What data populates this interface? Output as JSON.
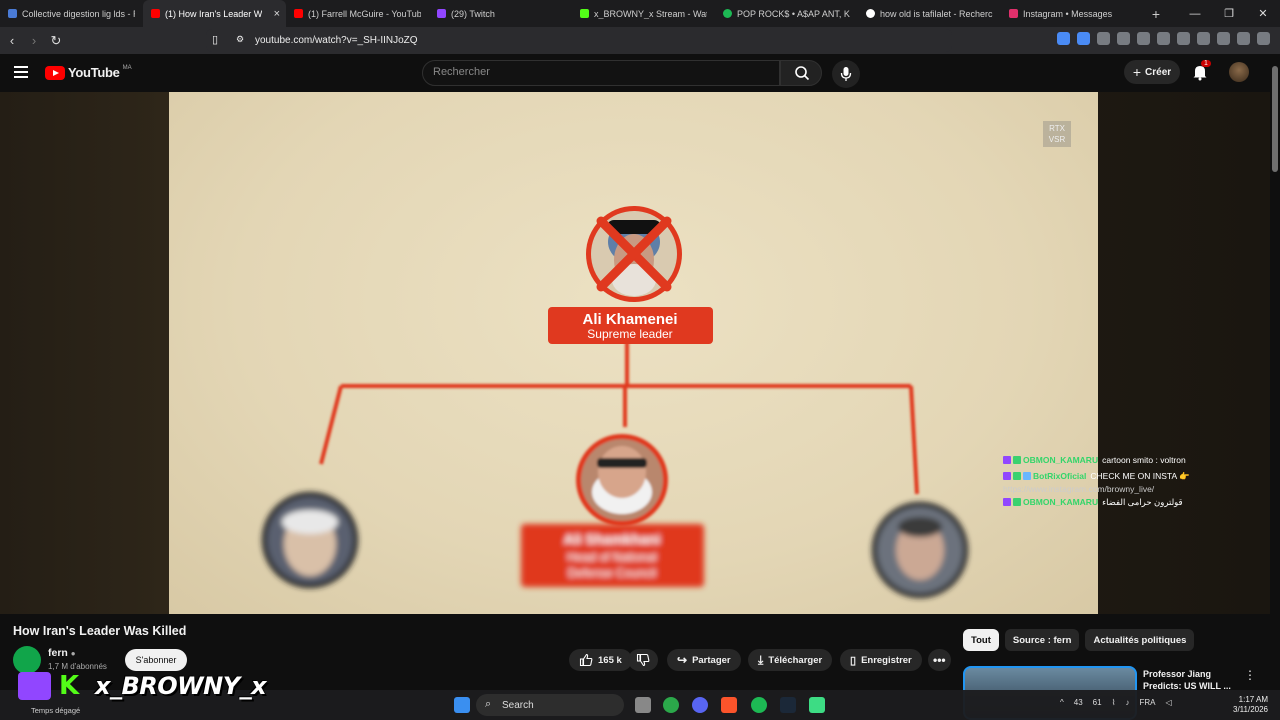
{
  "browser": {
    "tabs": [
      {
        "label": "Collective digestion lig lds - Re",
        "color": "#4a7bd6"
      },
      {
        "label": "(1) How Iran's Leader W",
        "color": "#ff0000",
        "active": true
      },
      {
        "label": "(1) Farrell McGuire - YouTube",
        "color": "#ff0000"
      },
      {
        "label": "(29) Twitch",
        "color": "#9146ff"
      },
      {
        "label": "x_BROWNY_x Stream - Watch",
        "color": "#53fc18"
      },
      {
        "label": "POP ROCK$ • A$AP ANT, K",
        "color": "#1db954"
      },
      {
        "label": "how old is tafilalet - Recherche",
        "color": "#ffffff"
      },
      {
        "label": "Instagram • Messages",
        "color": "#e1306c"
      }
    ],
    "url": "youtube.com/watch?v=_SH-IINJoZQ"
  },
  "youtube": {
    "logo_text": "YouTube",
    "country_code": "MA",
    "search_placeholder": "Rechercher",
    "create_label": "Créer",
    "notif_count": "1"
  },
  "video": {
    "overlay_badge_line1": "RTX",
    "overlay_badge_line2": "VSR",
    "diagram": {
      "top_name": "Ali Khamenei",
      "top_role": "Supreme leader",
      "mid_name": "Ali Shamkhani",
      "mid_role_line1": "Head of National",
      "mid_role_line2": "Defense Council"
    }
  },
  "chat": [
    {
      "user": "OBMON_KAMARU",
      "message": "cartoon smito : voltron"
    },
    {
      "user": "BotRixOficial",
      "message": "CHECK ME ON INSTA 👉",
      "link": "https://www.instagram.com/browny_live/"
    },
    {
      "user": "OBMON_KAMARU",
      "message": "قولترون حرامى الفضاء"
    }
  ],
  "info": {
    "title": "How Iran's Leader Was Killed",
    "channel": "fern",
    "subscribers": "1,7 M d'abonnés",
    "subscribe_label": "S'abonner",
    "likes": "165 k",
    "share": "Partager",
    "download": "Télécharger",
    "save": "Enregistrer"
  },
  "chips": [
    "Tout",
    "Source : fern",
    "Actualités politiques"
  ],
  "reco": {
    "title_line1": "Professor Jiang",
    "title_line2": "Predicts: US WILL ..."
  },
  "stream_overlay": {
    "name": "x_BROWNY_x"
  },
  "weather": "Temps dégagé",
  "taskbar": {
    "search": "Search",
    "tray_temp": "43",
    "tray_num": "61",
    "lang": "FRA",
    "time": "1:17 AM",
    "date": "3/11/2026"
  },
  "colors": {
    "yt_red": "#ff0000",
    "diagram_red": "#e0391f",
    "chat_green": "#33d56a",
    "twitch_purple": "#9146ff",
    "kick_green": "#53fc18"
  }
}
